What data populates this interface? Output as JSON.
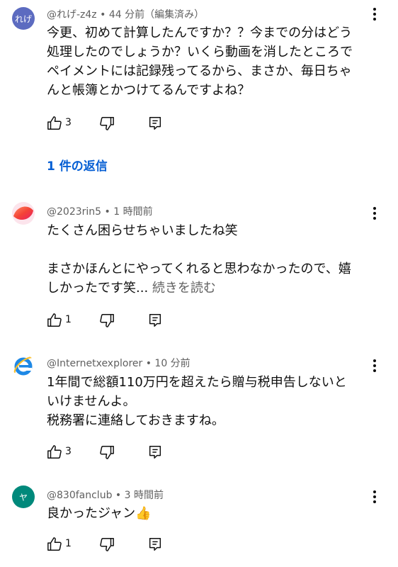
{
  "colors": {
    "reply_link": "#065fd4",
    "meta_text": "#606060",
    "avatar_rebuge": "#5c6bc0",
    "avatar_830": "#00897b"
  },
  "icons": {
    "like": "thumbs-up-icon",
    "dislike": "thumbs-down-icon",
    "reply": "reply-comment-icon",
    "menu": "more-vert-icon"
  },
  "comments": [
    {
      "avatar_text": "れげ",
      "meta": "@れげ-z4z • 44 分前（編集済み）",
      "lines": [
        "今更、初めて計算したんですか？？今までの分はどう",
        "処理したのでしょうか？いくら動画を消したところで",
        "ペイメントには記録残ってるから、まさか、毎日ちゃ",
        "んと帳簿とかつけてるんですよね？"
      ],
      "likes": "3",
      "replies_label": "1 件の返信"
    },
    {
      "meta": "@2023rin5 • 1 時間前",
      "lines": [
        "たくさん困らせちゃいましたね笑",
        "",
        "まさかほんとにやってくれると思わなかったので、嬉",
        "しかったです笑..."
      ],
      "read_more": "続きを読む",
      "likes": "1"
    },
    {
      "meta": "@Internetxexplorer • 10 分前",
      "lines": [
        "1年間で総額110万円を超えたら贈与税申告しないと",
        "いけませんよ。",
        "税務署に連絡しておきますね。"
      ],
      "likes": "3"
    },
    {
      "avatar_text": "ヤ",
      "meta": "@830fanclub • 3 時間前",
      "lines": [
        "良かったジャン👍"
      ],
      "likes": "1"
    }
  ]
}
